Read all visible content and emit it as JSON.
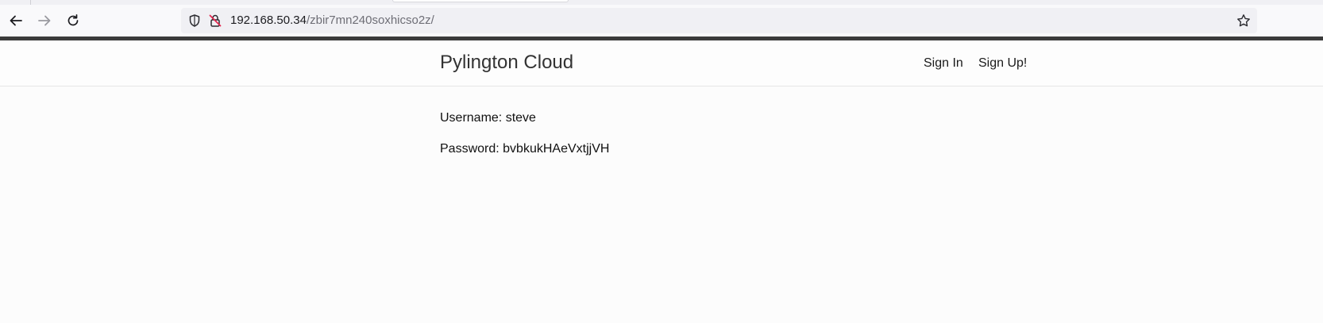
{
  "browser": {
    "url_host": "192.168.50.34",
    "url_path": "/zbir7mn240soxhicso2z/",
    "icons": {
      "back": "arrow-left-icon",
      "forward": "arrow-right-icon",
      "reload": "reload-icon",
      "tracking": "shield-icon",
      "security": "insecure-lock-icon",
      "bookmark": "star-icon"
    }
  },
  "site": {
    "brand": "Pylington Cloud",
    "nav": {
      "sign_in": "Sign In",
      "sign_up": "Sign Up!"
    }
  },
  "credentials": {
    "username_line": "Username: steve",
    "password_line": "Password: bvbkukHAeVxtjjVH"
  },
  "colors": {
    "chrome_border": "#3b3b3b",
    "page_background": "#fcfcfc",
    "insecure_lock_slash": "#e22850"
  }
}
